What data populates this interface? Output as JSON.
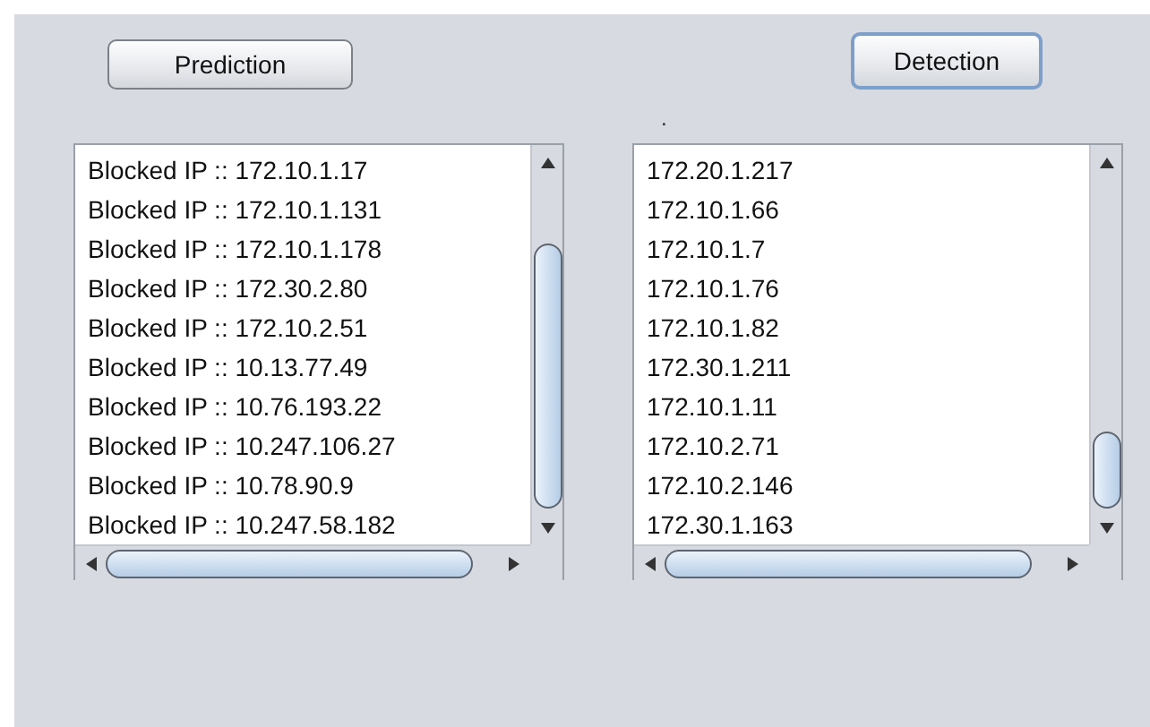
{
  "buttons": [
    {
      "label": "Prediction",
      "focused": false
    },
    {
      "label": "Detection",
      "focused": true
    }
  ],
  "status_label": ".",
  "lists": [
    {
      "items": [
        "Blocked IP :: 172.10.1.17",
        "Blocked IP :: 172.10.1.131",
        "Blocked IP :: 172.10.1.178",
        "Blocked IP :: 172.30.2.80",
        "Blocked IP :: 172.10.2.51",
        "Blocked IP :: 10.13.77.49",
        "Blocked IP :: 10.76.193.22",
        "Blocked IP :: 10.247.106.27",
        "Blocked IP :: 10.78.90.9",
        "Blocked IP :: 10.247.58.182"
      ]
    },
    {
      "items": [
        "172.20.1.217",
        "172.10.1.66",
        "172.10.1.7",
        "172.10.1.76",
        "172.10.1.82",
        "172.30.1.211",
        "172.10.1.11",
        "172.10.2.71",
        "172.10.2.146",
        "172.30.1.163"
      ]
    }
  ]
}
